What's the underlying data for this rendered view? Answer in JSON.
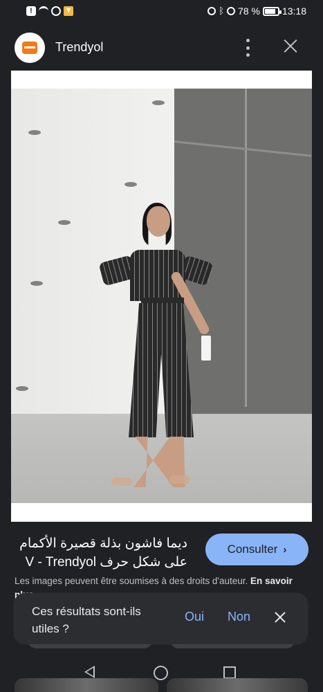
{
  "status_bar": {
    "battery": "78 %",
    "time": "13:18"
  },
  "header": {
    "title": "Trendyol"
  },
  "product": {
    "title": "ديما فاشون بذلة قصيرة الأكمام على شكل حرف V - Trendyol",
    "button": "Consulter"
  },
  "copyright": {
    "text": "Les images peuvent être soumises à des droits d'auteur.",
    "more": "En savoir plus"
  },
  "feedback": {
    "question": "Ces résultats sont-ils utiles ?",
    "yes": "Oui",
    "no": "Non"
  },
  "icons": {
    "alert": "alert-icon",
    "wifi": "wifi-icon",
    "clock": "clock-icon",
    "download": "download-icon",
    "bluetooth": "bluetooth-icon",
    "battery": "battery-icon",
    "close": "close-icon",
    "more": "more-icon"
  },
  "colors": {
    "background": "#202124",
    "accent": "#8ab4f8",
    "brand": "#f27a1a"
  }
}
